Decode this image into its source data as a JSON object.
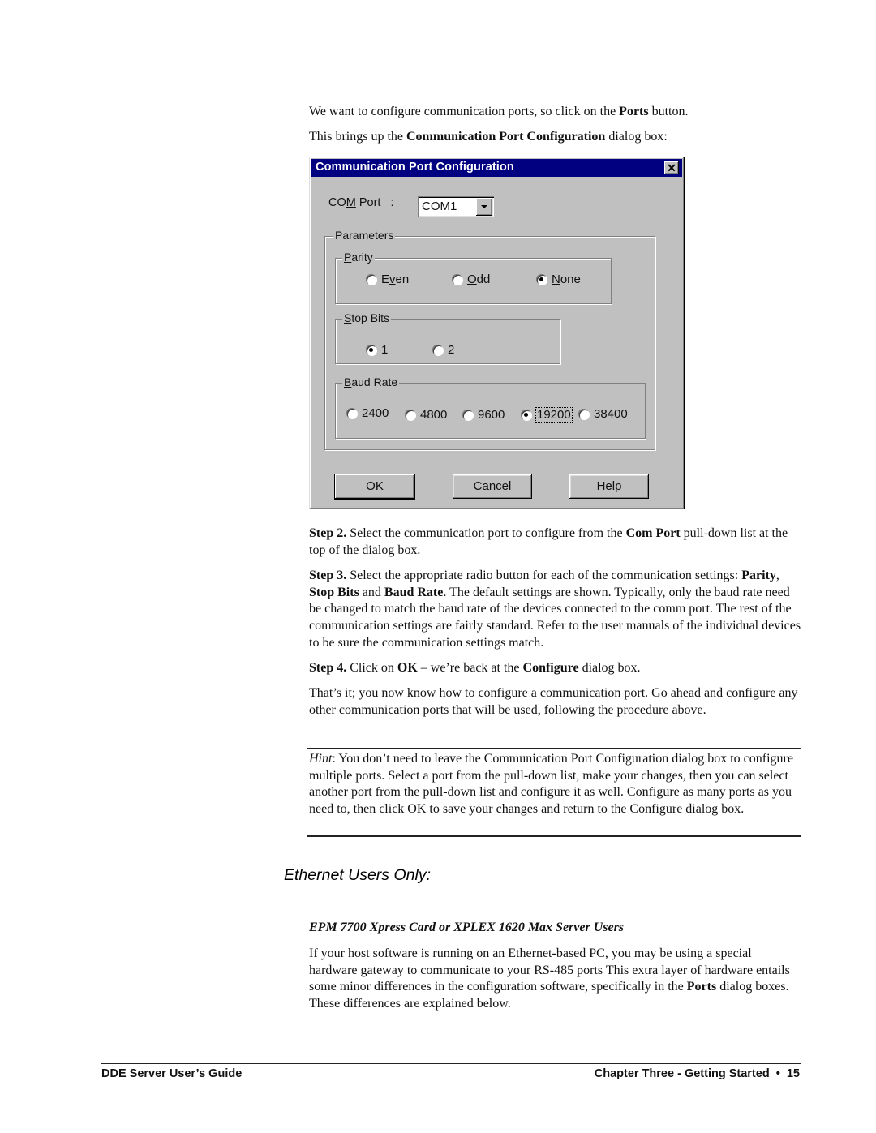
{
  "intro": {
    "line1": {
      "pre": "We want to configure communication ports, so click on the ",
      "bold": "Ports",
      "post": " button."
    },
    "line2": {
      "pre": "This brings up the ",
      "bold": "Communication Port Configuration",
      "post": " dialog box:"
    }
  },
  "dialog": {
    "title": "Communication Port Configuration",
    "close_glyph": "✕",
    "com_port": {
      "label_pre": "CO",
      "label_u": "M",
      "label_post": " Port   :",
      "value": "COM1"
    },
    "parameters_label": "Parameters",
    "parity": {
      "label_u": "P",
      "label_rest": "arity",
      "options": [
        {
          "pre": "E",
          "u": "v",
          "post": "en",
          "selected": false
        },
        {
          "pre": "",
          "u": "O",
          "post": "dd",
          "selected": false
        },
        {
          "pre": "",
          "u": "N",
          "post": "one",
          "selected": true
        }
      ]
    },
    "stop_bits": {
      "label_u": "S",
      "label_rest": "top Bits",
      "options": [
        {
          "label": "1",
          "selected": true
        },
        {
          "label": "2",
          "selected": false
        }
      ]
    },
    "baud_rate": {
      "label_u": "B",
      "label_rest": "aud Rate",
      "options": [
        {
          "label": "2400",
          "selected": false
        },
        {
          "label": "4800",
          "selected": false
        },
        {
          "label": "9600",
          "selected": false
        },
        {
          "label": "19200",
          "selected": true
        },
        {
          "label": "38400",
          "selected": false
        }
      ]
    },
    "buttons": {
      "ok": {
        "pre": "O",
        "u": "K",
        "post": ""
      },
      "cancel": {
        "pre": "",
        "u": "C",
        "post": "ancel"
      },
      "help": {
        "pre": "",
        "u": "H",
        "post": "elp"
      }
    }
  },
  "steps": {
    "step2": {
      "label": "Step 2.",
      "t1": " Select the communication port to configure from the ",
      "b1": "Com Port",
      "t2": " pull-down list at the top of the dialog box."
    },
    "step3": {
      "label": "Step 3.",
      "t1": " Select the appropriate radio button for each of the communication settings: ",
      "b1": "Parity",
      "t2": ", ",
      "b2": "Stop Bits",
      "t3": " and ",
      "b3": "Baud Rate",
      "t4": ". The default settings are shown. Typically, only the baud rate need be changed to match the baud rate of the devices connected to the comm port. The rest of the communication settings are fairly standard. Refer to the user manuals of the individual devices to be sure the communication settings match."
    },
    "step4": {
      "label": "Step 4.",
      "t1": " Click on ",
      "b1": "OK",
      "t2": " – we’re back at the ",
      "b2": "Configure",
      "t3": " dialog box."
    }
  },
  "closing": "That’s it; you now know how to configure a communication port. Go ahead and configure any other communication ports that will be used, following the procedure above.",
  "hint": {
    "label": "Hint",
    "text": ": You don’t need to leave the Communication Port Configuration dialog box to configure multiple ports. Select a port from the pull-down list, make your changes, then you can select another port from the pull-down list and configure it as well. Configure as many ports as you need to, then click OK to save your changes and return to the Configure dialog box."
  },
  "section": {
    "heading": "Ethernet Users Only:",
    "subheading": "EPM 7700 Xpress Card or XPLEX 1620 Max Server Users",
    "body": {
      "t1": "If your host software is running on an Ethernet-based PC, you may be using a special hardware gateway to communicate to your RS-485 ports This extra layer of hardware entails some minor differences in the configuration software, specifically in the ",
      "b1": "Ports",
      "t2": " dialog boxes. These differences are explained below."
    }
  },
  "footer": {
    "left": "DDE Server User’s Guide",
    "right": "Chapter Three - Getting Started  •  15"
  }
}
